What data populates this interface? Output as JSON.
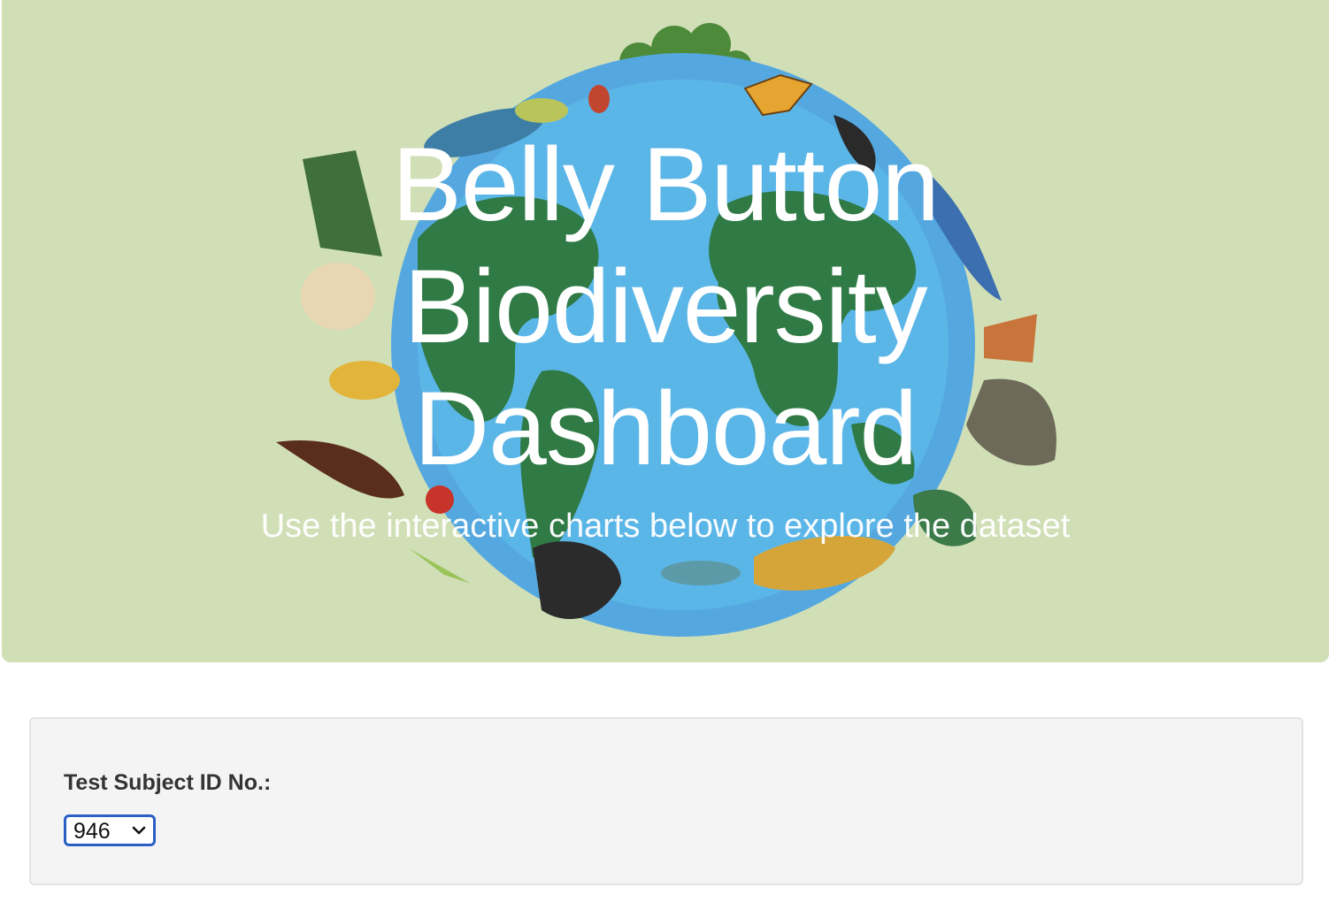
{
  "hero": {
    "title_lines": [
      "Belly Button",
      "Biodiversity",
      "Dashboard"
    ],
    "subtitle": "Use the interactive charts below to explore the dataset",
    "background_color": "#d1dfb7",
    "illustration": "earth-biodiversity-icon"
  },
  "selector": {
    "label": "Test Subject ID No.:",
    "selected_value": "946",
    "icon": "chevron-down-icon"
  }
}
